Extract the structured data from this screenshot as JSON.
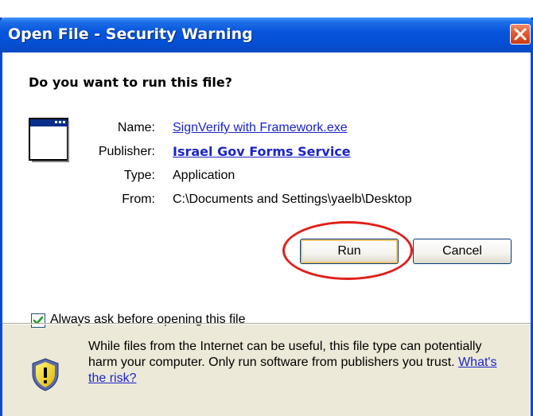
{
  "dialog": {
    "title": "Open File - Security Warning",
    "question": "Do you want to run this file?",
    "fields": [
      {
        "label": "Name:",
        "value": "SignVerify with Framework.exe"
      },
      {
        "label": "Publisher:",
        "value": "Israel Gov Forms Service"
      },
      {
        "label": "Type:",
        "value": "Application"
      },
      {
        "label": "From:",
        "value": "C:\\Documents and Settings\\yaelb\\Desktop"
      }
    ],
    "buttons": {
      "run_label": "Run",
      "cancel_label": "Cancel"
    },
    "checkbox": {
      "label": "Always ask before opening this file",
      "checked": true
    },
    "warning": {
      "text": "While files from the Internet can be useful, this file type can potentially harm your computer. Only run software from publishers you trust.",
      "link_text": "What's the risk?"
    }
  },
  "icons": {
    "close": "close-icon",
    "application": "application-window-icon",
    "shield": "security-shield-icon",
    "checkmark": "checkmark-icon"
  },
  "colors": {
    "titlebar": "#0755dc",
    "close_button": "#e45a32",
    "link": "#1b24c9",
    "highlight": "#e0201a",
    "dialog_face": "#ece9d8"
  }
}
